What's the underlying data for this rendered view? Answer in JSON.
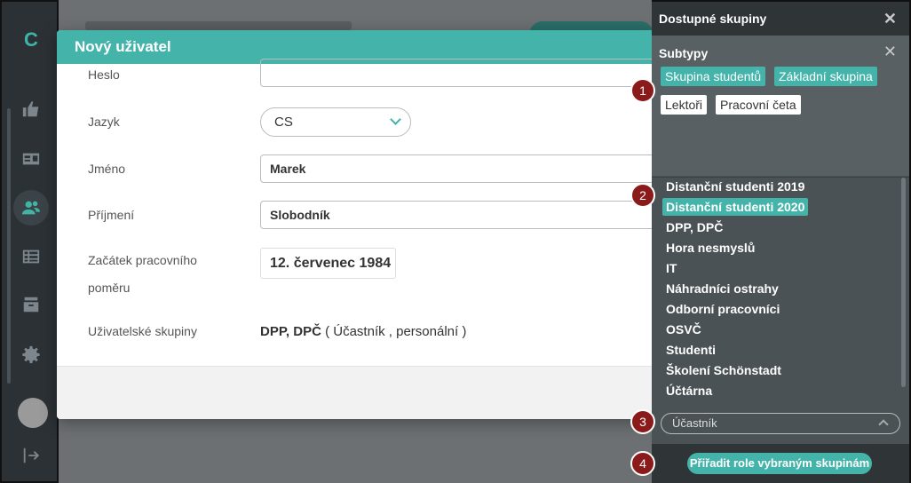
{
  "app": {
    "logo": "C"
  },
  "modal": {
    "title": "Nový uživatel",
    "fields": {
      "password_label": "Heslo",
      "password_value": "",
      "language_label": "Jazyk",
      "language_value": "CS",
      "first_name_label": "Jméno",
      "first_name_value": "Marek",
      "last_name_label": "Příjmení",
      "last_name_value": "Slobodník",
      "start_label_line1": "Začátek pracovního",
      "start_label_line2": "poměru",
      "start_value": "12. červenec 1984",
      "groups_label": "Uživatelské skupiny",
      "groups_value": "DPP, DPČ",
      "groups_roles": "( Účastník , personální )"
    }
  },
  "panel": {
    "title": "Dostupné skupiny",
    "subtypes_title": "Subtypy",
    "subtypes": [
      {
        "label": "Skupina studentů",
        "selected": true
      },
      {
        "label": "Základní skupina",
        "selected": true
      },
      {
        "label": "Lektoři",
        "selected": false
      },
      {
        "label": "Pracovní četa",
        "selected": false
      }
    ],
    "groups": [
      {
        "label": "Distanční studenti 2019",
        "selected": false
      },
      {
        "label": "Distanční studenti 2020",
        "selected": true
      },
      {
        "label": "DPP, DPČ",
        "selected": false
      },
      {
        "label": "Hora nesmyslů",
        "selected": false
      },
      {
        "label": "IT",
        "selected": false
      },
      {
        "label": "Náhradníci ostrahy",
        "selected": false
      },
      {
        "label": "Odborní pracovníci",
        "selected": false
      },
      {
        "label": "OSVČ",
        "selected": false
      },
      {
        "label": "Studenti",
        "selected": false
      },
      {
        "label": "Školení Schönstadt",
        "selected": false
      },
      {
        "label": "Účtárna",
        "selected": false
      }
    ],
    "role_select_value": "Účastník",
    "assign_button": "Přiřadit role vybraným skupinám"
  },
  "callouts": [
    "1",
    "2",
    "3",
    "4"
  ],
  "colors": {
    "accent": "#44b3a9",
    "panel": "#4b5256",
    "rail": "#2b3135",
    "callout": "#8b1a1a"
  }
}
